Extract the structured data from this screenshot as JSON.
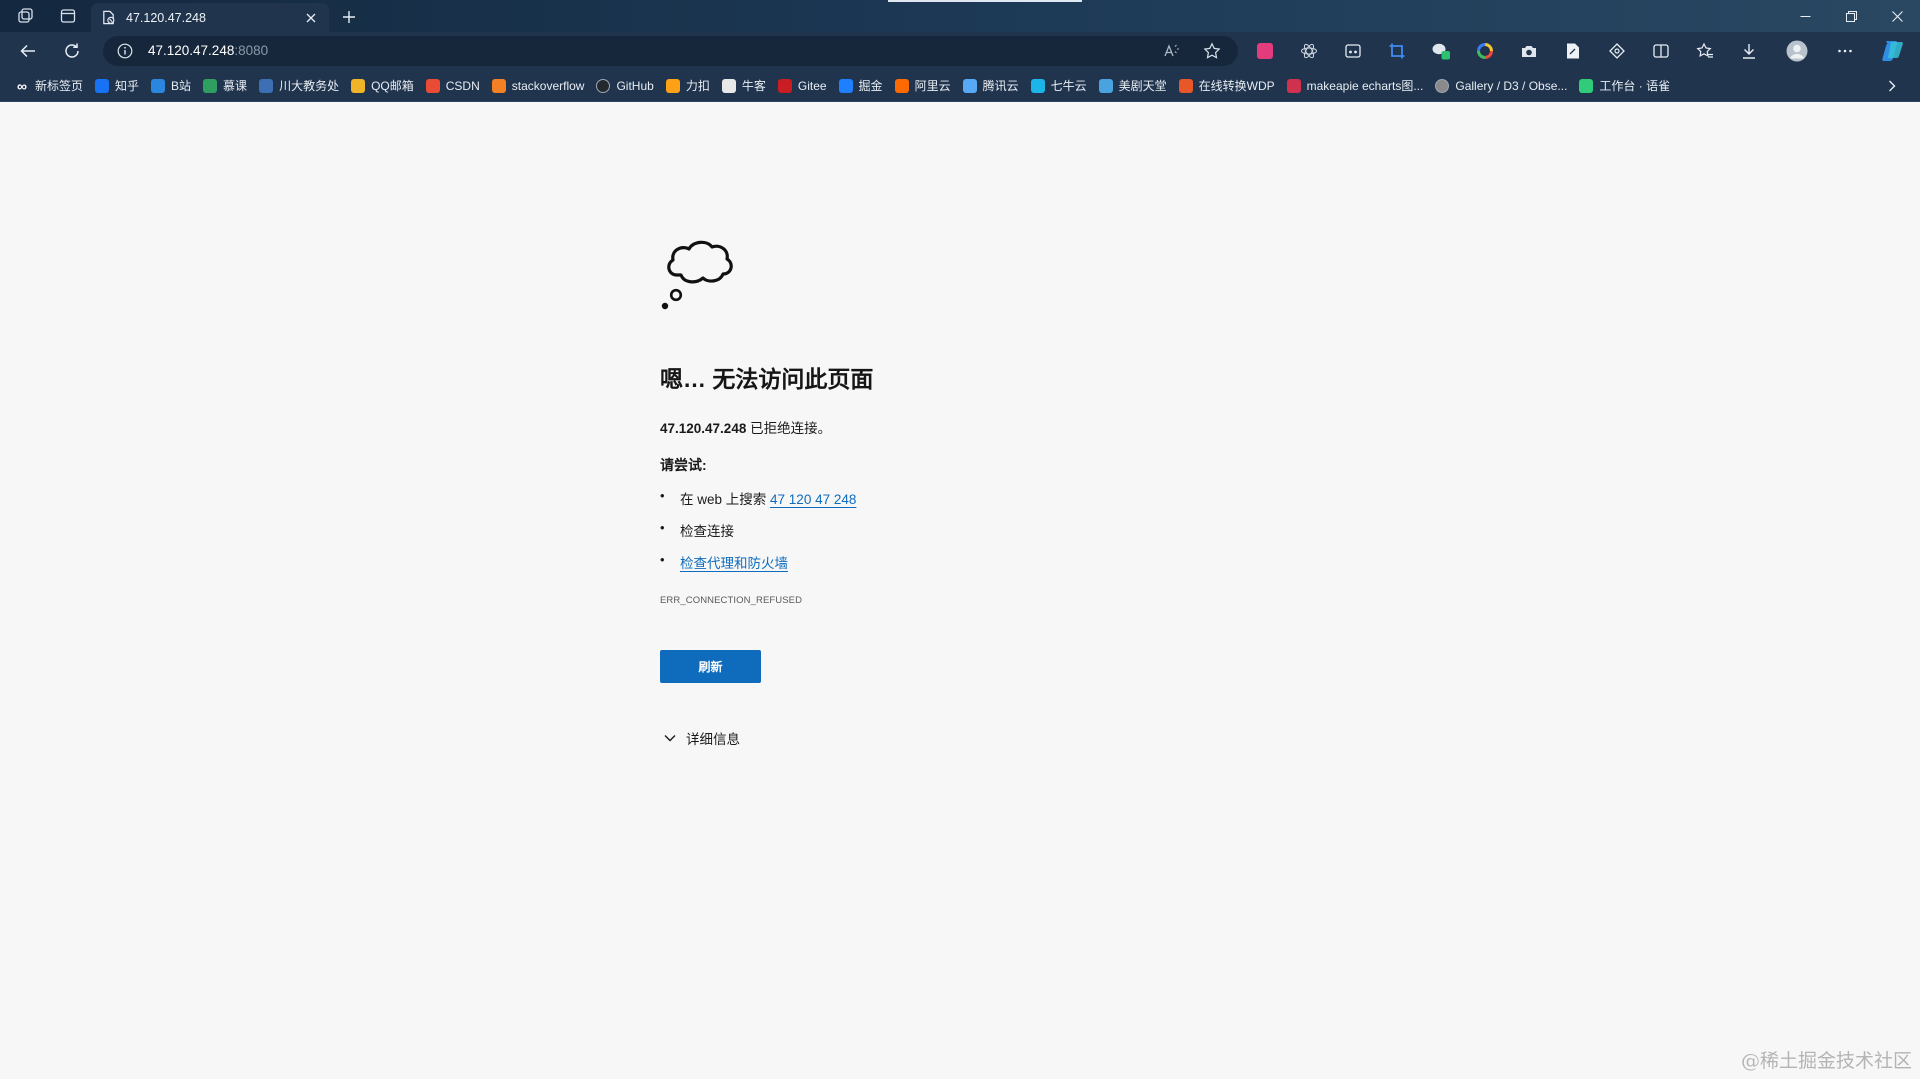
{
  "tab": {
    "title": "47.120.47.248"
  },
  "address_bar": {
    "host": "47.120.47.248",
    "port": ":8080"
  },
  "bookmarks": [
    {
      "label": "新标签页",
      "icon": "infinity-icon",
      "color": "#ffffff"
    },
    {
      "label": "知乎",
      "icon": "zhihu-icon",
      "color": "#1772f6"
    },
    {
      "label": "B站",
      "icon": "bilibili-icon",
      "color": "#2b86e0"
    },
    {
      "label": "慕课",
      "icon": "mooc-icon",
      "color": "#2f9e61"
    },
    {
      "label": "川大教务处",
      "icon": "urp-icon",
      "color": "#3d6fb5"
    },
    {
      "label": "QQ邮箱",
      "icon": "qqmail-icon",
      "color": "#f0b429"
    },
    {
      "label": "CSDN",
      "icon": "csdn-icon",
      "color": "#e94b35"
    },
    {
      "label": "stackoverflow",
      "icon": "stackoverflow-icon",
      "color": "#f48024"
    },
    {
      "label": "GitHub",
      "icon": "github-icon",
      "color": "#24292f"
    },
    {
      "label": "力扣",
      "icon": "leetcode-icon",
      "color": "#ffa116"
    },
    {
      "label": "牛客",
      "icon": "nowcoder-icon",
      "color": "#e8e8e8"
    },
    {
      "label": "Gitee",
      "icon": "gitee-icon",
      "color": "#c71d23"
    },
    {
      "label": "掘金",
      "icon": "juejin-icon",
      "color": "#1e80ff"
    },
    {
      "label": "阿里云",
      "icon": "aliyun-icon",
      "color": "#ff6a00"
    },
    {
      "label": "腾讯云",
      "icon": "tencentcloud-icon",
      "color": "#57a9f5"
    },
    {
      "label": "七牛云",
      "icon": "qiniu-icon",
      "color": "#1bb5e8"
    },
    {
      "label": "美剧天堂",
      "icon": "meijutt-icon",
      "color": "#4aa3df"
    },
    {
      "label": "在线转换WDP",
      "icon": "convert-icon",
      "color": "#e8572a"
    },
    {
      "label": "makeapie echarts图...",
      "icon": "makeapie-icon",
      "color": "#d0314f"
    },
    {
      "label": "Gallery / D3 / Obse...",
      "icon": "observable-icon",
      "color": "#8a8a8a"
    },
    {
      "label": "工作台 · 语雀",
      "icon": "yuque-icon",
      "color": "#31cc79"
    }
  ],
  "error_page": {
    "title": "嗯… 无法访问此页面",
    "host": "47.120.47.248",
    "refused_text": " 已拒绝连接。",
    "try_label": "请尝试:",
    "suggestion_search_prefix": "在 web 上搜索 ",
    "suggestion_search_link": "47 120 47 248",
    "suggestion_check_connection": "检查连接",
    "suggestion_check_proxy": "检查代理和防火墙",
    "error_code": "ERR_CONNECTION_REFUSED",
    "refresh_label": "刷新",
    "details_label": "详细信息"
  },
  "watermark": "@稀土掘金技术社区"
}
